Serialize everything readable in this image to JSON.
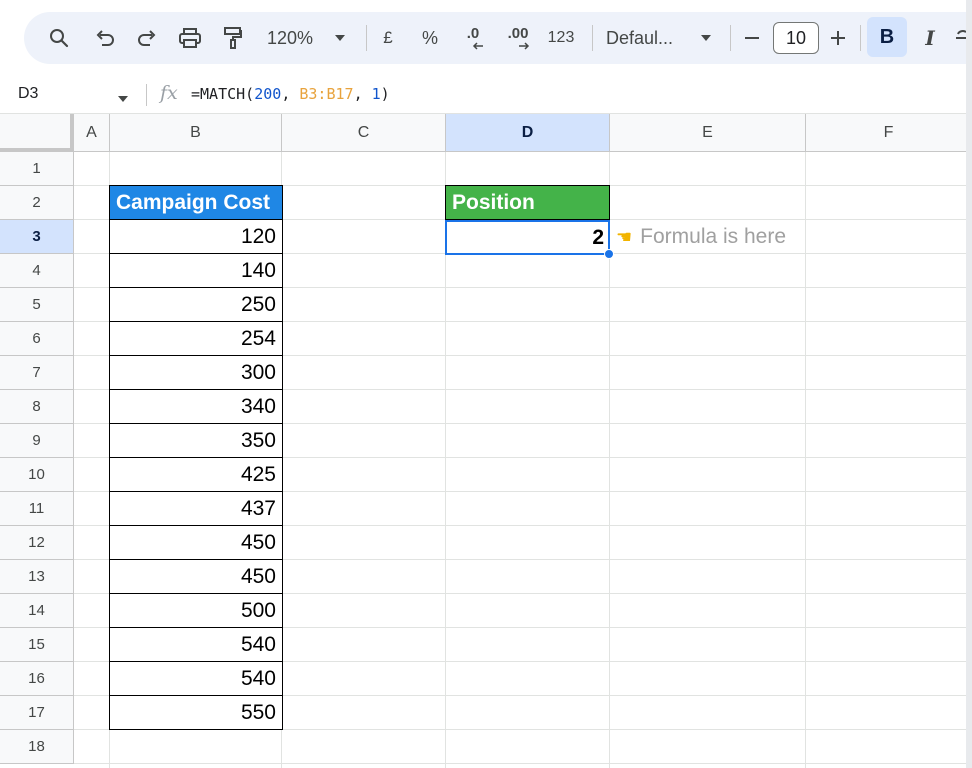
{
  "toolbar": {
    "zoom": "120%",
    "currency": "£",
    "percent": "%",
    "decrease_decimal": ".0",
    "increase_decimal": ".00",
    "number_format": "123",
    "font": "Defaul...",
    "font_size": "10",
    "bold": "B",
    "italic": "I"
  },
  "formula_bar": {
    "cell_ref": "D3",
    "fx": "fx",
    "formula_prefix": "=MATCH(",
    "arg1": "200",
    "sep1": ", ",
    "arg2": "B3:B17",
    "sep2": ", ",
    "arg3": "1",
    "formula_suffix": ")"
  },
  "columns": [
    "A",
    "B",
    "C",
    "D",
    "E",
    "F"
  ],
  "rows": [
    "1",
    "2",
    "3",
    "4",
    "5",
    "6",
    "7",
    "8",
    "9",
    "10",
    "11",
    "12",
    "13",
    "14",
    "15",
    "16",
    "17",
    "18"
  ],
  "sheet": {
    "b_header": "Campaign Cost",
    "b_values": [
      "120",
      "140",
      "250",
      "254",
      "300",
      "340",
      "350",
      "425",
      "437",
      "450",
      "450",
      "500",
      "540",
      "540",
      "550"
    ],
    "d_header": "Position",
    "d_value": "2",
    "note": "Formula is here",
    "note_icon": "pointing-hand"
  },
  "colors": {
    "b_header_bg": "#1f87e5",
    "d_header_bg": "#44b349",
    "selection": "#1a73e8"
  }
}
